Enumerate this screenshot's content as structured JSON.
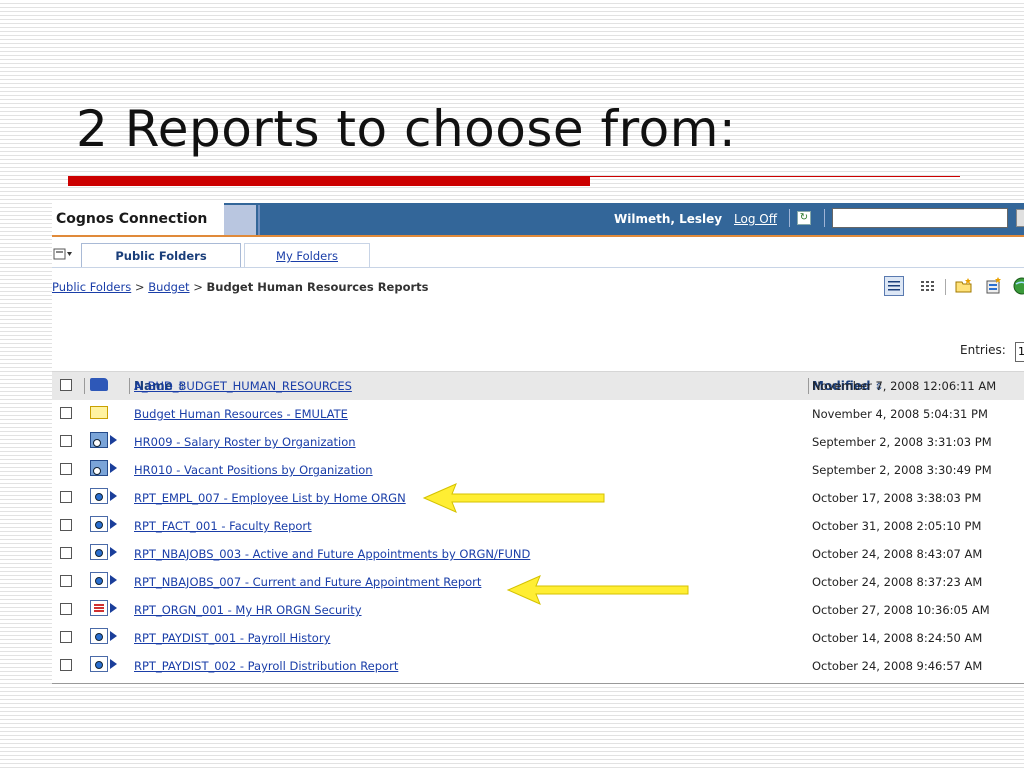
{
  "slide": {
    "title": "2 Reports to choose from:",
    "accent_color": "#cc0000"
  },
  "app": {
    "brand": "Cognos Connection",
    "user_name": "Wilmeth, Lesley",
    "logoff_label": "Log Off",
    "header_color": "#336699",
    "refresh_icon": "refresh-icon",
    "search_value": ""
  },
  "tabs": [
    {
      "label": "Public Folders",
      "active": true
    },
    {
      "label": "My Folders",
      "active": false
    }
  ],
  "breadcrumb": {
    "items": [
      "Public Folders",
      "Budget"
    ],
    "separator": ">",
    "current": "Budget Human Resources Reports"
  },
  "toolbar": {
    "icons": [
      "details-view-icon",
      "list-view-icon",
      "new-folder-icon",
      "new-job-icon",
      "globe-icon"
    ]
  },
  "entries": {
    "label": "Entries:",
    "value": "1"
  },
  "table": {
    "columns": {
      "name": "Name",
      "modified": "Modified"
    },
    "rows": [
      {
        "icon": "folder-blue-icon",
        "name": "A_BUD_BUDGET_HUMAN_RESOURCES",
        "modified": "November 7, 2008 12:06:11 AM",
        "run": false
      },
      {
        "icon": "folder-yellow-icon",
        "name": "Budget Human Resources - EMULATE",
        "modified": "November 4, 2008 5:04:31 PM",
        "run": false
      },
      {
        "icon": "report-view-icon",
        "name": "HR009 - Salary Roster by Organization",
        "modified": "September 2, 2008 3:31:03 PM",
        "run": true
      },
      {
        "icon": "report-view-icon",
        "name": "HR010 - Vacant Positions by Organization",
        "modified": "September 2, 2008 3:30:49 PM",
        "run": true
      },
      {
        "icon": "report-icon",
        "name": "RPT_EMPL_007 - Employee List by Home ORGN",
        "modified": "October 17, 2008 3:38:03 PM",
        "run": true
      },
      {
        "icon": "report-icon",
        "name": "RPT_FACT_001 - Faculty Report",
        "modified": "October 31, 2008 2:05:10 PM",
        "run": true
      },
      {
        "icon": "report-icon",
        "name": "RPT_NBAJOBS_003 - Active and Future Appointments by ORGN/FUND",
        "modified": "October 24, 2008 8:43:07 AM",
        "run": true
      },
      {
        "icon": "report-icon",
        "name": "RPT_NBAJOBS_007 - Current and Future Appointment Report",
        "modified": "October 24, 2008 8:37:23 AM",
        "run": true
      },
      {
        "icon": "report-table-icon",
        "name": "RPT_ORGN_001 - My HR ORGN Security",
        "modified": "October 27, 2008 10:36:05 AM",
        "run": true
      },
      {
        "icon": "report-icon",
        "name": "RPT_PAYDIST_001 - Payroll History",
        "modified": "October 14, 2008 8:24:50 AM",
        "run": true
      },
      {
        "icon": "report-icon",
        "name": "RPT_PAYDIST_002 - Payroll Distribution Report",
        "modified": "October 24, 2008 9:46:57 AM",
        "run": true
      }
    ]
  },
  "callouts": {
    "color": "#ffee33",
    "targets": [
      "RPT_EMPL_007 - Employee List by Home ORGN",
      "RPT_NBAJOBS_007 - Current and Future Appointment Report"
    ]
  }
}
